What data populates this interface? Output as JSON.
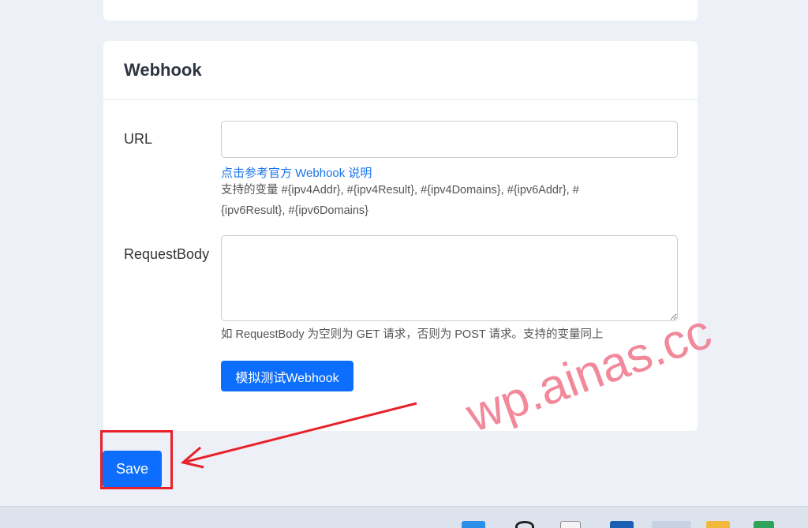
{
  "webhook": {
    "title": "Webhook",
    "url_label": "URL",
    "url_value": "",
    "help_link": "点击参考官方 Webhook 说明",
    "variables_line1": "支持的变量 #{ipv4Addr}, #{ipv4Result}, #{ipv4Domains}, #{ipv6Addr}, #",
    "variables_line2": "{ipv6Result}, #{ipv6Domains}",
    "body_label": "RequestBody",
    "body_value": "",
    "body_help": "如 RequestBody 为空则为 GET 请求，否则为 POST 请求。支持的变量同上",
    "test_button": "模拟测试Webhook"
  },
  "save_button": "Save",
  "watermark": "wp.ainas.cc",
  "colors": {
    "primary": "#0d6efd",
    "link": "#1a73e8",
    "annotation": "#e8202a",
    "watermark": "#f07d91",
    "page_bg": "#eef0f7"
  },
  "taskbar": {
    "icons": [
      "windows-start-icon",
      "search-icon",
      "file-icon",
      "store-icon",
      "edge-icon",
      "folder-icon",
      "app-icon"
    ]
  }
}
